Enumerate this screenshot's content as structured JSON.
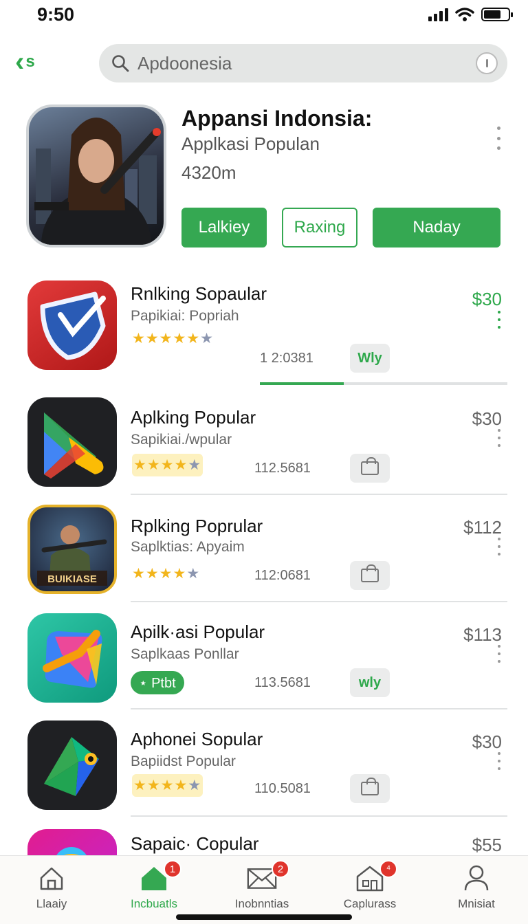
{
  "status_bar": {
    "time": "9:50"
  },
  "nav": {
    "back_label": "s",
    "search_placeholder": "Apdoonesia"
  },
  "header": {
    "title": "Appansi Indonsia:",
    "subtitle": "Applkasi Populan",
    "count": "4320m",
    "buttons": [
      "Lalkiey",
      "Raxing",
      "Naday"
    ]
  },
  "apps": [
    {
      "name": "Rnlking Sopaular",
      "subtitle": "Papikiai: Popriah",
      "rating": 4.5,
      "meta": "1 2:0381",
      "price": "$30",
      "action": "Wly",
      "progress": 0.34
    },
    {
      "name": "Aplking Popular",
      "subtitle": "Sapikiai./wpular",
      "rating": 4,
      "meta": "112.5681",
      "price": "$30"
    },
    {
      "name": "Rplking Poprular",
      "subtitle": "Saplktias: Apyaim",
      "rating": 4,
      "meta": "112:0681",
      "price": "$112",
      "icon_text": "BUIKIASE"
    },
    {
      "name": "Apilk·asi Popular",
      "subtitle": "Saplkaas Ponllar",
      "badge": "⋆ Ptbt",
      "meta": "113.5681",
      "price": "$113",
      "action": "wly"
    },
    {
      "name": "Aphonei Sopular",
      "subtitle": "Bapiidst Popular",
      "rating": 4,
      "meta": "110.5081",
      "price": "$30"
    },
    {
      "name": "Sapaic· Copular",
      "price": "$55"
    }
  ],
  "tabs": [
    {
      "label": "Llaaiy",
      "icon": "home-outline-icon"
    },
    {
      "label": "Incbuatls",
      "icon": "home-filled-icon",
      "badge": "1"
    },
    {
      "label": "Inobnntias",
      "icon": "mail-icon",
      "badge": "2"
    },
    {
      "label": "Caplurass",
      "icon": "store-icon",
      "badge": "⁴"
    },
    {
      "label": "Mnisiat",
      "icon": "person-icon"
    }
  ],
  "colors": {
    "accent": "#35a852",
    "star": "#f2b51c",
    "badge": "#e0342c"
  }
}
